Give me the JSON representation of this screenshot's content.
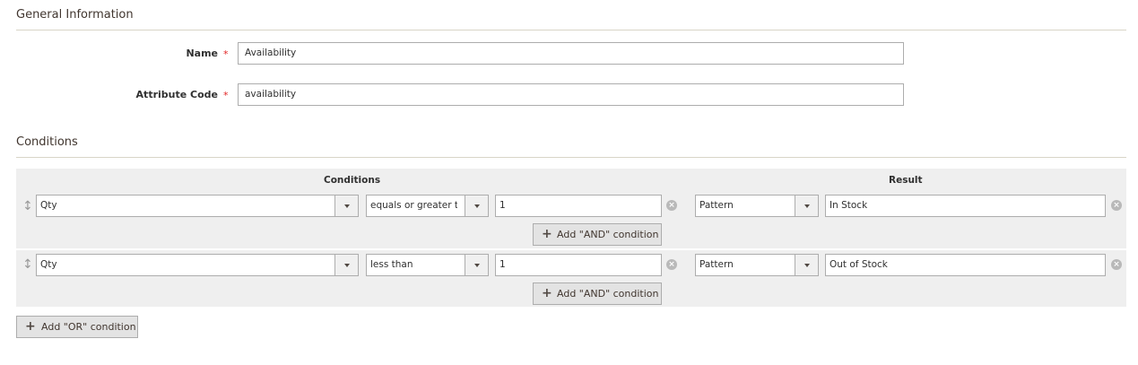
{
  "general": {
    "title": "General Information",
    "name_label": "Name",
    "name_value": "Availability",
    "code_label": "Attribute Code",
    "code_value": "availability",
    "required_mark": "*"
  },
  "conditions_section": {
    "title": "Conditions",
    "col_conditions": "Conditions",
    "col_result": "Result",
    "rows": [
      {
        "attribute": "Qty",
        "operator": "equals or greater th",
        "value": "1",
        "result_type": "Pattern",
        "result_value": "In Stock",
        "add_and_label": "Add \"AND\" condition"
      },
      {
        "attribute": "Qty",
        "operator": "less than",
        "value": "1",
        "result_type": "Pattern",
        "result_value": "Out of Stock",
        "add_and_label": "Add \"AND\" condition"
      }
    ],
    "add_or_label": "Add \"OR\" condition"
  },
  "icons": {
    "drag": "drag-handle-icon",
    "remove": "remove-circle-icon",
    "plus": "plus-icon",
    "dropdown": "chevron-down-icon"
  },
  "colors": {
    "required": "#e22626",
    "grid_bg": "#efefef",
    "rule": "#d9d5c7"
  }
}
